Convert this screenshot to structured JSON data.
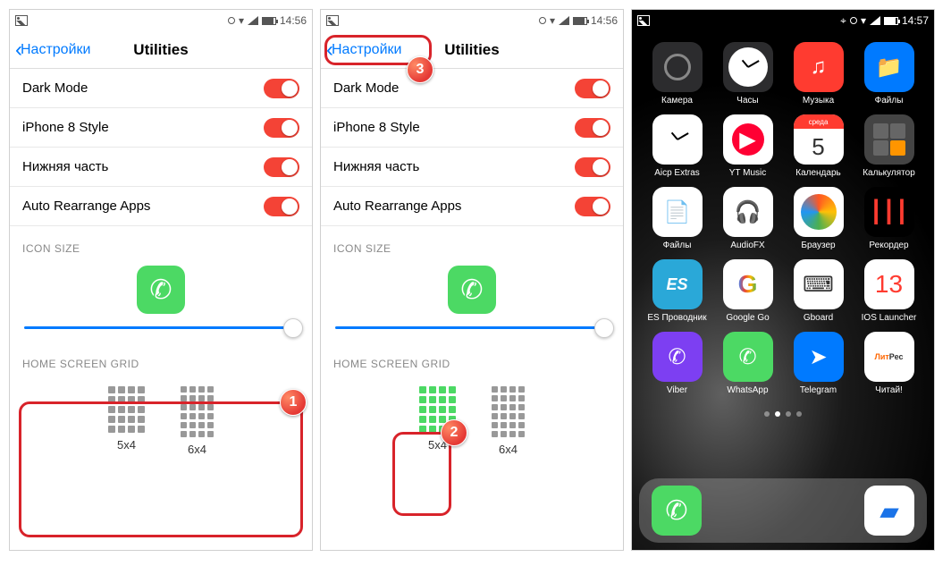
{
  "status": {
    "time1": "14:56",
    "time2": "14:57"
  },
  "nav": {
    "back": "Настройки",
    "title": "Utilities"
  },
  "toggles": [
    {
      "label": "Dark Mode",
      "on": true
    },
    {
      "label": "iPhone 8 Style",
      "on": true
    },
    {
      "label": "Нижняя часть",
      "on": true
    },
    {
      "label": "Auto Rearrange Apps",
      "on": true
    }
  ],
  "section_icon": "ICON SIZE",
  "section_grid": "HOME SCREEN GRID",
  "grid_options": {
    "a": "5x4",
    "b": "6x4"
  },
  "calendar": {
    "dow": "среда",
    "day": "5"
  },
  "ios13": "13",
  "apps": [
    {
      "name": "Камера",
      "icon": "camera",
      "bg": "bg-dark"
    },
    {
      "name": "Часы",
      "icon": "clock",
      "bg": "bg-dark"
    },
    {
      "name": "Музыка",
      "icon": "music",
      "bg": "bg-red",
      "glyph": "♫"
    },
    {
      "name": "Файлы",
      "icon": "folder",
      "bg": "bg-blue",
      "glyph": "📁"
    },
    {
      "name": "Aicp Extras",
      "icon": "clock2",
      "bg": "bg-white"
    },
    {
      "name": "YT Music",
      "icon": "yt",
      "bg": "bg-white"
    },
    {
      "name": "Календарь",
      "icon": "calendar",
      "bg": "bg-white"
    },
    {
      "name": "Калькулятор",
      "icon": "calc",
      "bg": "bg-gray",
      "glyph": "⊞"
    },
    {
      "name": "Файлы",
      "icon": "files2",
      "bg": "bg-white",
      "glyph": "📄"
    },
    {
      "name": "AudioFX",
      "icon": "audio",
      "bg": "bg-white",
      "glyph": "🎧"
    },
    {
      "name": "Браузер",
      "icon": "browser",
      "bg": "bg-white",
      "glyph": "🌐"
    },
    {
      "name": "Рекордер",
      "icon": "rec",
      "bg": "bg-black",
      "glyph": "┃┃┃"
    },
    {
      "name": "ES Проводник",
      "icon": "es",
      "bg": "bg-teal",
      "glyph": "ES"
    },
    {
      "name": "Google Go",
      "icon": "google",
      "bg": "bg-white",
      "glyph": "G"
    },
    {
      "name": "Gboard",
      "icon": "gboard",
      "bg": "bg-white",
      "glyph": "⌨"
    },
    {
      "name": "IOS Launcher",
      "icon": "ios",
      "bg": "bg-white"
    },
    {
      "name": "Viber",
      "icon": "viber",
      "bg": "bg-purple",
      "glyph": "✆"
    },
    {
      "name": "WhatsApp",
      "icon": "wa",
      "bg": "bg-green",
      "glyph": "✆"
    },
    {
      "name": "Telegram",
      "icon": "tg",
      "bg": "bg-blue",
      "glyph": "➤"
    },
    {
      "name": "Читай!",
      "icon": "litres",
      "bg": "bg-lit",
      "glyph": "Лит"
    }
  ],
  "dock": [
    {
      "icon": "phone",
      "bg": "bg-green",
      "glyph": "📞"
    },
    {
      "icon": "messages",
      "bg": "bg-white",
      "glyph": "💬"
    }
  ],
  "annotations": {
    "b1": "1",
    "b2": "2",
    "b3": "3"
  }
}
